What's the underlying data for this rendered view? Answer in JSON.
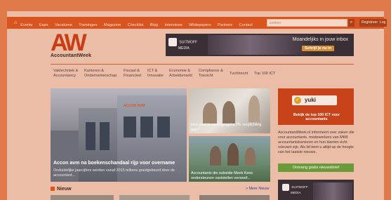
{
  "topbar": {
    "home_icon": "home-icon",
    "nav": [
      "Events",
      "Expo",
      "Vacatures",
      "Trainingen",
      "Magazine",
      "Checklist",
      "Blog",
      "Interviews",
      "Whitepapers",
      "Partners",
      "Contact"
    ],
    "search_placeholder": "zoeken",
    "register": "Registreer",
    "login": "Log in"
  },
  "logo": {
    "mark": "AW",
    "name": "AccountantWeek"
  },
  "banner": {
    "brand_line1": "SUITMOFF",
    "brand_line2": "MEDIA",
    "headline": "Moandeljiks in jouw inbox",
    "cta": "Schrijf je nu in"
  },
  "categories": [
    [
      "Vaktechniek &",
      "Accountancy"
    ],
    [
      "Kantoren &",
      "Ondernemerschap"
    ],
    [
      "Fiscaal &",
      "Financieel"
    ],
    [
      "ICT &",
      "Innovatie"
    ],
    [
      "Economie &",
      "Arbeidsmarkt"
    ],
    [
      "Compliance &",
      "Toezicht"
    ],
    [
      "Tuchtrecht"
    ],
    [
      "Top 100 ICT"
    ]
  ],
  "hero": {
    "title": "Accon avm na boekenschandaal rijp voor overname",
    "sub": "Onduidelijke jaarcijfers werden vanaf 2015 telkens goedgekeurd door de accountant...",
    "signage": "ACCON AVM"
  },
  "cards": [
    {
      "caption": "Hoe gaat je verstagegging PE verplichting aan?"
    },
    {
      "caption": "Accountants die subsidie Meek Kees ondersteunen vaststellen verweef..."
    }
  ],
  "sidebar": {
    "yuki": "yuki",
    "yuki_line": "Bekijk de top 100 ICT voor accountants",
    "about": "AccountantWeek.nl informeert over zaken die voor accountants, medewerkers van MKB accountantskantoren en hun klanten écht relevant zijn. Als lid bent u altijd op de hoogte van het laatste nieuws.",
    "newsletter": "Ontvang gratis nieuwsbrief",
    "ad_line1": "SUITMOFF",
    "ad_line2": "MEDIA"
  },
  "news": {
    "title": "Nieuw",
    "more": "> Meer Nieuw"
  },
  "colors": {
    "accent": "#d9541f",
    "logo": "#c93d14",
    "green": "#6a9a3a",
    "link": "#2a3f9a"
  }
}
